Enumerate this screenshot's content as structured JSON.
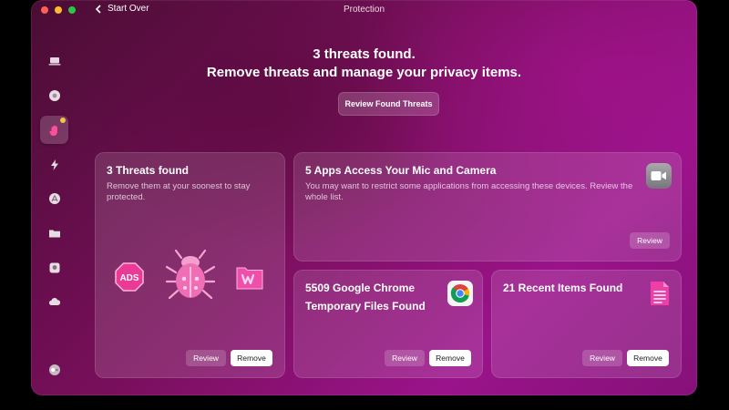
{
  "window": {
    "title": "Protection",
    "back_label": "Start Over"
  },
  "sidebar": {
    "items": [
      {
        "icon": "laptop-icon"
      },
      {
        "icon": "shield-disc-icon"
      },
      {
        "icon": "hand-icon",
        "active": true
      },
      {
        "icon": "lightning-icon"
      },
      {
        "icon": "appstore-icon"
      },
      {
        "icon": "folder-icon"
      },
      {
        "icon": "disk-icon"
      },
      {
        "icon": "cloud-icon"
      },
      {
        "icon": "toggle-icon"
      }
    ]
  },
  "header": {
    "line1": "3 threats found.",
    "line2": "Remove threats and manage your privacy items.",
    "button": "Review Found Threats"
  },
  "cards": {
    "threats": {
      "title": "3 Threats found",
      "desc": "Remove them at your soonest to stay protected.",
      "icons": [
        "ads-icon",
        "bug-icon",
        "malware-app-icon"
      ],
      "ads_label": "ADS",
      "review": "Review",
      "remove": "Remove"
    },
    "mic": {
      "title": "5 Apps Access Your Mic and Camera",
      "desc": "You may want to restrict some applications from accessing these devices. Review the whole list.",
      "icon": "camera-icon",
      "review": "Review"
    },
    "chrome": {
      "title_line1": "5509 Google Chrome",
      "title_line2": "Temporary Files Found",
      "icon": "chrome-icon",
      "review": "Review",
      "remove": "Remove"
    },
    "recent": {
      "title": "21 Recent Items Found",
      "icon": "document-icon",
      "review": "Review",
      "remove": "Remove"
    }
  },
  "colors": {
    "accent_pink": "#e0339f",
    "badge": "#f5c542"
  }
}
